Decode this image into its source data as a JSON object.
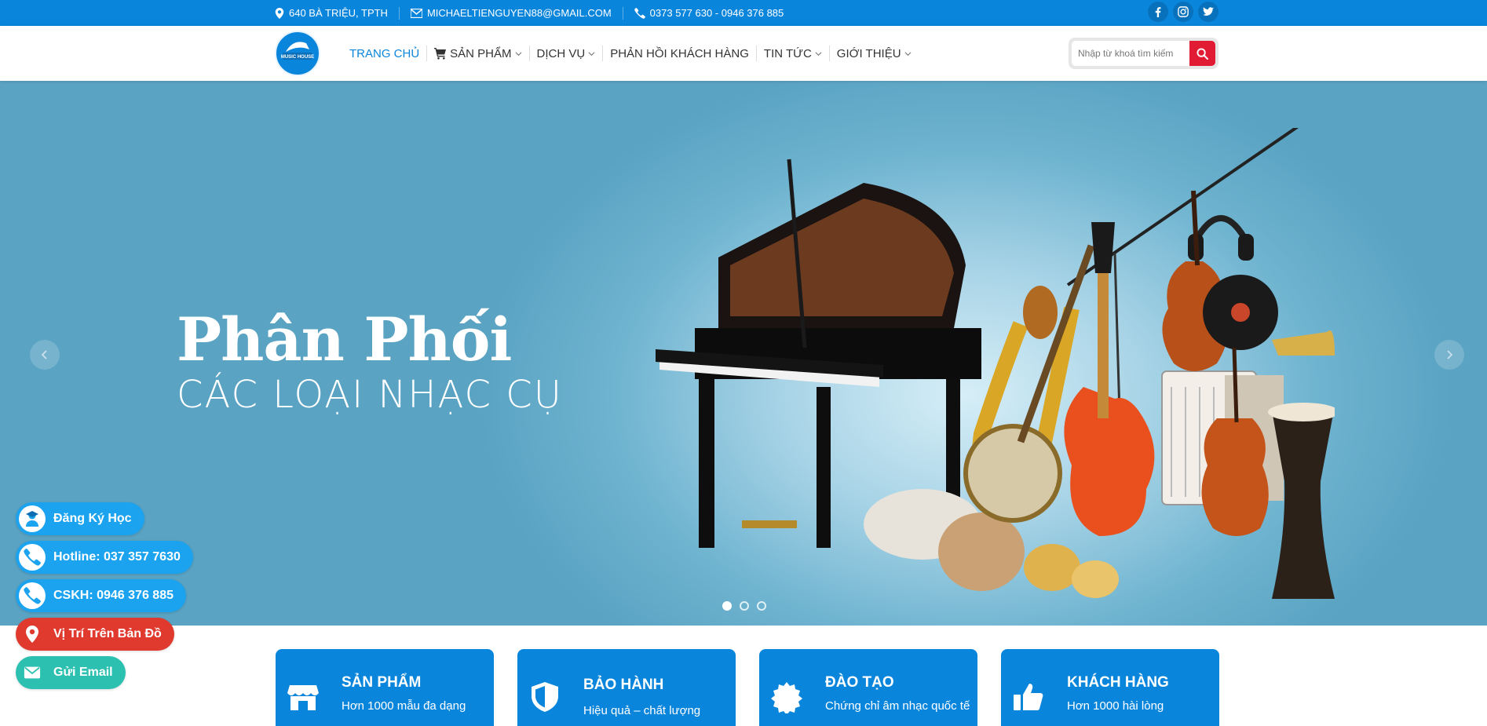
{
  "topbar": {
    "address": "640 BÀ TRIỆU, TPTH",
    "email": "MICHAELTIENGUYEN88@GMAIL.COM",
    "phone": "0373 577 630 - 0946 376 885",
    "social_icons": [
      "facebook-icon",
      "instagram-icon",
      "twitter-icon"
    ]
  },
  "logo": {
    "text": "MUSIC HOUSE"
  },
  "nav": {
    "items": [
      {
        "label": "TRANG CHỦ",
        "active": true
      },
      {
        "label": "SẢN PHẨM",
        "icon": "cart-icon",
        "dropdown": true
      },
      {
        "label": "DỊCH VỤ",
        "dropdown": true
      },
      {
        "label": "PHẢN HỒI KHÁCH HÀNG"
      },
      {
        "label": "TIN TỨC",
        "dropdown": true
      },
      {
        "label": "GIỚI THIỆU",
        "dropdown": true
      }
    ]
  },
  "search": {
    "placeholder": "Nhập từ khoá tìm kiếm",
    "value": ""
  },
  "hero": {
    "title": "Phân Phối",
    "subtitle": "CÁC LOẠI NHẠC CỤ",
    "slides": 3,
    "active_slide": 1
  },
  "floating_buttons": [
    {
      "label": "Đăng Ký Học",
      "icon": "student-icon",
      "color": "#1ba3f0"
    },
    {
      "label": "Hotline: 037 357 7630",
      "icon": "phone-icon",
      "color": "#1ba3f0"
    },
    {
      "label": "CSKH: 0946 376 885",
      "icon": "phone-icon",
      "color": "#1ba3f0"
    },
    {
      "label": "Vị Trí Trên Bản Đồ",
      "icon": "map-pin-icon",
      "color": "#e03a2f"
    },
    {
      "label": "Gửi Email",
      "icon": "mail-icon",
      "color": "#2cc0b0"
    }
  ],
  "features": [
    {
      "title": "SẢN PHẨM",
      "subtitle": "Hơn 1000 mẫu đa dạng",
      "icon": "store-icon"
    },
    {
      "title": "BẢO HÀNH",
      "subtitle": "Hiệu quả – chất lượng",
      "icon": "shield-icon"
    },
    {
      "title": "ĐÀO TẠO",
      "subtitle": "Chứng chỉ âm nhạc quốc tế",
      "icon": "badge-icon"
    },
    {
      "title": "KHÁCH HÀNG",
      "subtitle": "Hơn 1000 hài lòng",
      "icon": "thumbs-up-icon"
    }
  ],
  "colors": {
    "primary": "#0a85dc",
    "search_button": "#e21b35",
    "float_blue": "#1ba3f0",
    "float_red": "#e03a2f",
    "float_teal": "#2cc0b0"
  }
}
